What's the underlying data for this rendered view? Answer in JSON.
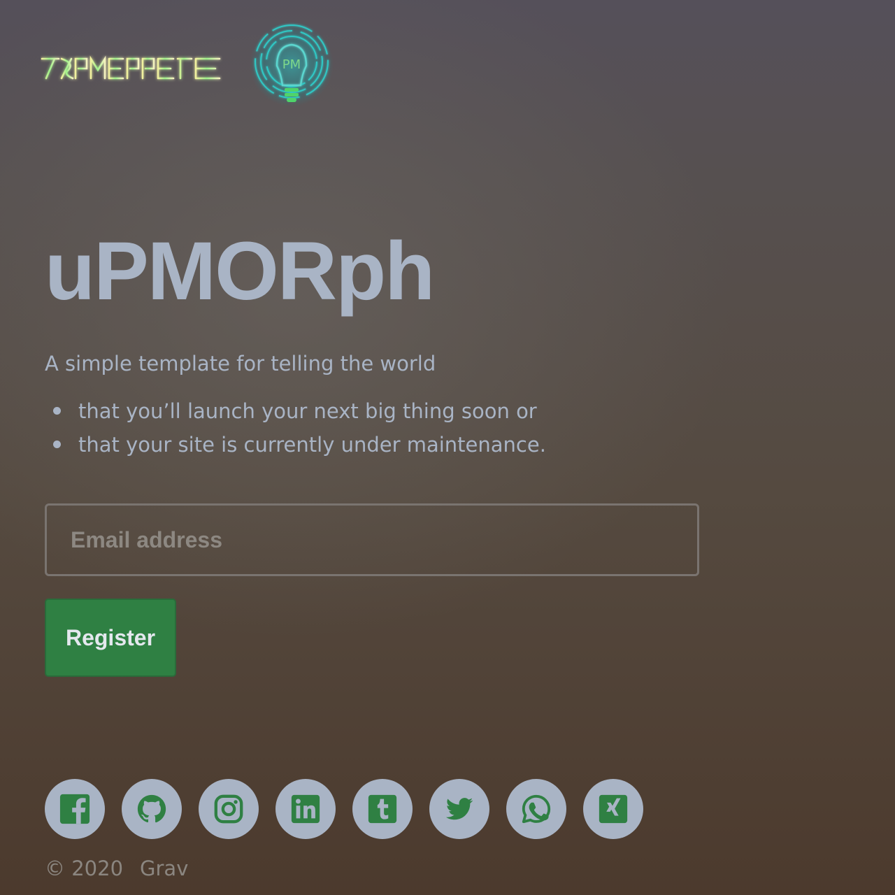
{
  "brand": {
    "wordmark_text": "ПАРМЕРРЕ",
    "logo_icon": "lightbulb-logo-icon",
    "logo_monogram": "PM"
  },
  "hero": {
    "title": "uPMORph",
    "intro": "A simple template for telling the world",
    "bullets": [
      "that you’ll launch your next big thing soon or",
      "that your site is currently under maintenance."
    ]
  },
  "form": {
    "email_placeholder": "Email address",
    "email_value": "",
    "register_label": "Register"
  },
  "social": [
    {
      "name": "facebook",
      "icon": "facebook-icon"
    },
    {
      "name": "github",
      "icon": "github-icon"
    },
    {
      "name": "instagram",
      "icon": "instagram-icon"
    },
    {
      "name": "linkedin",
      "icon": "linkedin-icon"
    },
    {
      "name": "tumblr",
      "icon": "tumblr-icon"
    },
    {
      "name": "twitter",
      "icon": "twitter-icon"
    },
    {
      "name": "whatsapp",
      "icon": "whatsapp-icon"
    },
    {
      "name": "xing",
      "icon": "xing-icon"
    }
  ],
  "footer": {
    "copyright": "© 2020",
    "powered_by": "Grav"
  },
  "colors": {
    "text": "#a9b4c5",
    "accent_green": "#2f8043",
    "icon_green": "#2f8043",
    "social_bg": "#a9b4c5",
    "wordmark_glow": "#d8e85a",
    "bulb_glow": "#27c7c7"
  }
}
